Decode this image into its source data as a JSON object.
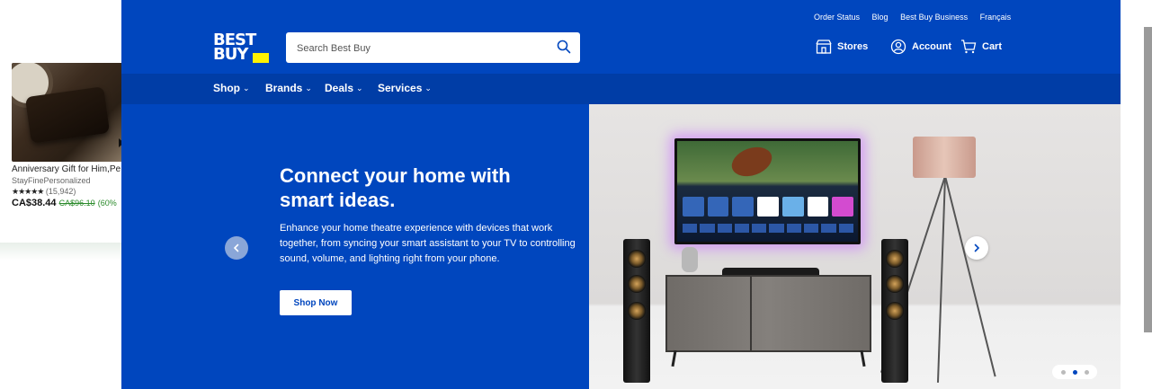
{
  "ad": {
    "title": "Anniversary Gift for Him,Pe",
    "store": "StayFinePersonalized",
    "stars": "★★★★★",
    "rating_count": "(15,942)",
    "price": "CA$38.44",
    "old_price": "CA$96.10",
    "discount": "(60%"
  },
  "header": {
    "logo_line1": "BEST",
    "logo_line2": "BUY",
    "search_placeholder": "Search Best Buy",
    "top_links": [
      "Order Status",
      "Blog",
      "Best Buy Business",
      "Français"
    ],
    "stores": "Stores",
    "account": "Account",
    "cart": "Cart"
  },
  "nav": [
    {
      "label": "Shop"
    },
    {
      "label": "Brands"
    },
    {
      "label": "Deals"
    },
    {
      "label": "Services"
    }
  ],
  "hero": {
    "title": "Connect your home with smart ideas.",
    "body": "Enhance your home theatre experience with devices that work together, from syncing your smart assistant to your TV to controlling sound, volume, and lighting right from your phone.",
    "cta": "Shop Now",
    "slide_index": 2,
    "slide_count": 3
  },
  "colors": {
    "brand_blue": "#0046be",
    "nav_blue": "#003da6",
    "logo_yellow": "#fff200"
  }
}
